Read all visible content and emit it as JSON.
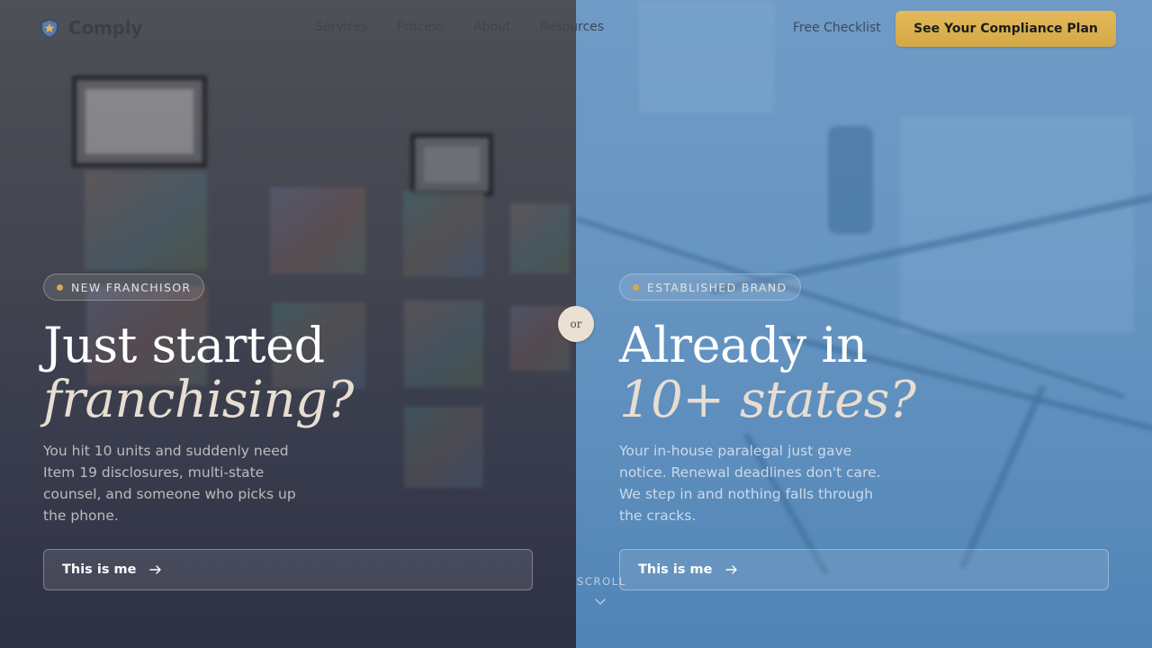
{
  "brand": {
    "name": "Comply"
  },
  "nav": {
    "items": [
      "Services",
      "Process",
      "About",
      "Resources"
    ]
  },
  "header": {
    "free_link": "Free Checklist",
    "cta": "See Your Compliance Plan"
  },
  "left": {
    "badge": "NEW FRANCHISOR",
    "heading_line1": "Just started",
    "heading_line2": "franchising?",
    "description": "You hit 10 units and suddenly need Item 19 disclosures, multi-state counsel, and someone who picks up the phone.",
    "button": "This is me"
  },
  "right": {
    "badge": "ESTABLISHED BRAND",
    "heading_line1": "Already in",
    "heading_line2": "10+ states?",
    "description": "Your in-house paralegal just gave notice. Renewal deadlines don't care. We step in and nothing falls through the cracks.",
    "button": "This is me"
  },
  "divider": {
    "label": "or"
  },
  "scroll": {
    "label": "SCROLL"
  },
  "colors": {
    "accent_gold": "#d8aa4e",
    "cta_bg": "#deb352",
    "left_panel": "#4a4d56",
    "right_panel": "#6b98c4"
  },
  "icons": {
    "logo": "shield-star-icon",
    "button_arrow": "arrow-right-icon",
    "scroll": "chevron-down-icon"
  }
}
